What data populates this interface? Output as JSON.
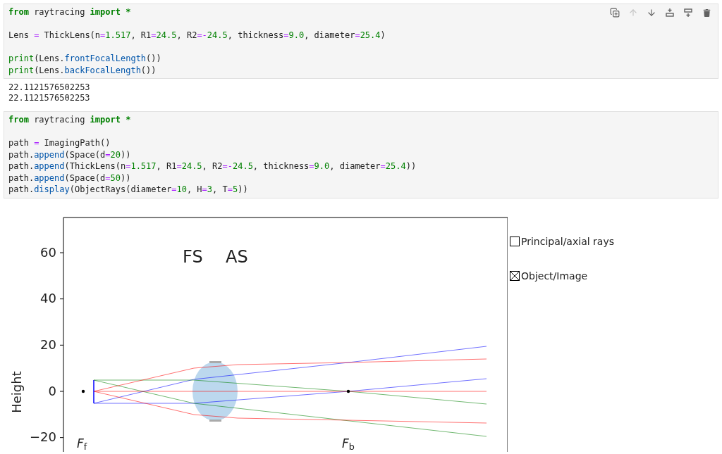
{
  "cells": [
    {
      "toolbar": [
        {
          "kind": "duplicate",
          "disabled": false
        },
        {
          "kind": "move-up",
          "disabled": true
        },
        {
          "kind": "move-down",
          "disabled": false
        },
        {
          "kind": "insert-above",
          "disabled": false
        },
        {
          "kind": "insert-below",
          "disabled": false
        },
        {
          "kind": "delete",
          "disabled": false
        }
      ],
      "code": [
        {
          "kind": "code",
          "tokens": [
            {
              "text": "from",
              "kind": "kw"
            },
            {
              "text": " raytracing ",
              "kind": "tx"
            },
            {
              "text": "import",
              "kind": "kw"
            },
            {
              "text": " *",
              "kind": "kw"
            }
          ]
        },
        {
          "kind": "blank"
        },
        {
          "kind": "code",
          "tokens": [
            {
              "text": "Lens ",
              "kind": "tx"
            },
            {
              "text": "=",
              "kind": "op"
            },
            {
              "text": " ThickLens(n",
              "kind": "tx"
            },
            {
              "text": "=",
              "kind": "op"
            },
            {
              "text": "1.517",
              "kind": "num"
            },
            {
              "text": ", R1",
              "kind": "tx"
            },
            {
              "text": "=",
              "kind": "op"
            },
            {
              "text": "24.5",
              "kind": "num"
            },
            {
              "text": ", R2",
              "kind": "tx"
            },
            {
              "text": "=-",
              "kind": "op"
            },
            {
              "text": "24.5",
              "kind": "num"
            },
            {
              "text": ", thickness",
              "kind": "tx"
            },
            {
              "text": "=",
              "kind": "op"
            },
            {
              "text": "9.0",
              "kind": "num"
            },
            {
              "text": ", diameter",
              "kind": "tx"
            },
            {
              "text": "=",
              "kind": "op"
            },
            {
              "text": "25.4",
              "kind": "num"
            },
            {
              "text": ")",
              "kind": "tx"
            }
          ]
        },
        {
          "kind": "blank"
        },
        {
          "kind": "code",
          "tokens": [
            {
              "text": "print",
              "kind": "bi"
            },
            {
              "text": "(Lens.",
              "kind": "tx"
            },
            {
              "text": "frontFocalLength",
              "kind": "fn"
            },
            {
              "text": "())",
              "kind": "tx"
            }
          ]
        },
        {
          "kind": "code",
          "tokens": [
            {
              "text": "print",
              "kind": "bi"
            },
            {
              "text": "(Lens.",
              "kind": "tx"
            },
            {
              "text": "backFocalLength",
              "kind": "fn"
            },
            {
              "text": "())",
              "kind": "tx"
            }
          ]
        }
      ],
      "output": [
        "22.1121576502253",
        "22.1121576502253"
      ]
    },
    {
      "code": [
        {
          "kind": "code",
          "tokens": [
            {
              "text": "from",
              "kind": "kw"
            },
            {
              "text": " raytracing ",
              "kind": "tx"
            },
            {
              "text": "import",
              "kind": "kw"
            },
            {
              "text": " *",
              "kind": "kw"
            }
          ]
        },
        {
          "kind": "blank"
        },
        {
          "kind": "code",
          "tokens": [
            {
              "text": "path ",
              "kind": "tx"
            },
            {
              "text": "=",
              "kind": "op"
            },
            {
              "text": " ImagingPath()",
              "kind": "tx"
            }
          ]
        },
        {
          "kind": "code",
          "tokens": [
            {
              "text": "path.",
              "kind": "tx"
            },
            {
              "text": "append",
              "kind": "fn"
            },
            {
              "text": "(Space(d",
              "kind": "tx"
            },
            {
              "text": "=",
              "kind": "op"
            },
            {
              "text": "20",
              "kind": "num"
            },
            {
              "text": "))",
              "kind": "tx"
            }
          ]
        },
        {
          "kind": "code",
          "tokens": [
            {
              "text": "path.",
              "kind": "tx"
            },
            {
              "text": "append",
              "kind": "fn"
            },
            {
              "text": "(ThickLens(n",
              "kind": "tx"
            },
            {
              "text": "=",
              "kind": "op"
            },
            {
              "text": "1.517",
              "kind": "num"
            },
            {
              "text": ", R1",
              "kind": "tx"
            },
            {
              "text": "=",
              "kind": "op"
            },
            {
              "text": "24.5",
              "kind": "num"
            },
            {
              "text": ", R2",
              "kind": "tx"
            },
            {
              "text": "=-",
              "kind": "op"
            },
            {
              "text": "24.5",
              "kind": "num"
            },
            {
              "text": ", thickness",
              "kind": "tx"
            },
            {
              "text": "=",
              "kind": "op"
            },
            {
              "text": "9.0",
              "kind": "num"
            },
            {
              "text": ", diameter",
              "kind": "tx"
            },
            {
              "text": "=",
              "kind": "op"
            },
            {
              "text": "25.4",
              "kind": "num"
            },
            {
              "text": "))",
              "kind": "tx"
            }
          ]
        },
        {
          "kind": "code",
          "tokens": [
            {
              "text": "path.",
              "kind": "tx"
            },
            {
              "text": "append",
              "kind": "fn"
            },
            {
              "text": "(Space(d",
              "kind": "tx"
            },
            {
              "text": "=",
              "kind": "op"
            },
            {
              "text": "50",
              "kind": "num"
            },
            {
              "text": "))",
              "kind": "tx"
            }
          ]
        },
        {
          "kind": "code",
          "tokens": [
            {
              "text": "path.",
              "kind": "tx"
            },
            {
              "text": "display",
              "kind": "fn"
            },
            {
              "text": "(ObjectRays(diameter",
              "kind": "tx"
            },
            {
              "text": "=",
              "kind": "op"
            },
            {
              "text": "10",
              "kind": "num"
            },
            {
              "text": ", H",
              "kind": "tx"
            },
            {
              "text": "=",
              "kind": "op"
            },
            {
              "text": "3",
              "kind": "num"
            },
            {
              "text": ", T",
              "kind": "tx"
            },
            {
              "text": "=",
              "kind": "op"
            },
            {
              "text": "5",
              "kind": "num"
            },
            {
              "text": "))",
              "kind": "tx"
            }
          ]
        }
      ]
    }
  ],
  "plot": {
    "ylabel": "Height",
    "yticks": [
      "60",
      "40",
      "20",
      "0",
      "−20"
    ],
    "stop_labels": [
      "FS",
      "AS"
    ],
    "focal_labels": [
      "*F*$_{f}$",
      "*F*$_{b}$"
    ]
  },
  "options": [
    {
      "label": "Principal/axial rays",
      "checked": false
    },
    {
      "label": "Object/Image",
      "checked": true
    }
  ]
}
